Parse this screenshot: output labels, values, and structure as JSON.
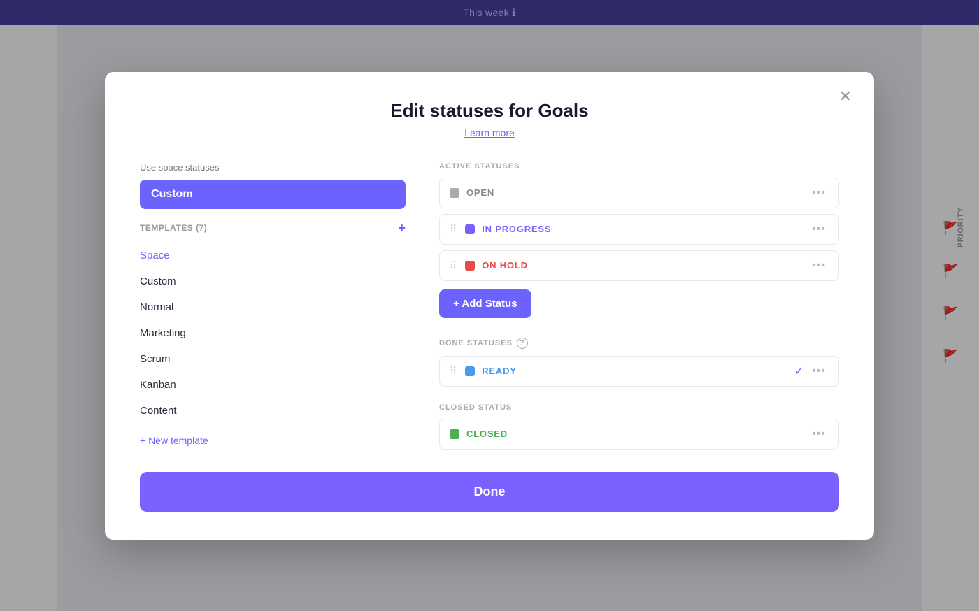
{
  "topbar": {
    "title": "This week",
    "info_icon": "ℹ"
  },
  "modal": {
    "title": "Edit statuses for Goals",
    "learn_more": "Learn more",
    "close_icon": "✕",
    "left": {
      "use_space_label": "Use space statuses",
      "custom_selected": "Custom",
      "templates_label": "TEMPLATES (7)",
      "templates_add_icon": "+",
      "templates": [
        {
          "label": "Space",
          "active": true
        },
        {
          "label": "Custom",
          "active": false
        },
        {
          "label": "Normal",
          "active": false
        },
        {
          "label": "Marketing",
          "active": false
        },
        {
          "label": "Scrum",
          "active": false
        },
        {
          "label": "Kanban",
          "active": false
        },
        {
          "label": "Content",
          "active": false
        }
      ],
      "new_template_label": "+ New template"
    },
    "right": {
      "active_statuses_label": "ACTIVE STATUSES",
      "statuses_active": [
        {
          "name": "OPEN",
          "color": "gray",
          "dot": "dot-gray"
        },
        {
          "name": "IN PROGRESS",
          "color": "purple",
          "dot": "dot-purple"
        },
        {
          "name": "ON HOLD",
          "color": "red",
          "dot": "dot-red"
        }
      ],
      "add_status_label": "+ Add Status",
      "done_statuses_label": "DONE STATUSES",
      "statuses_done": [
        {
          "name": "READY",
          "color": "blue",
          "dot": "dot-blue",
          "check": true
        }
      ],
      "closed_status_label": "CLOSED STATUS",
      "statuses_closed": [
        {
          "name": "CLOSED",
          "color": "green",
          "dot": "dot-green"
        }
      ]
    },
    "done_label": "Done"
  },
  "priority": {
    "label": "PRIORITY",
    "flags": [
      "🚩",
      "🚩",
      "🚩",
      "🚩"
    ]
  }
}
